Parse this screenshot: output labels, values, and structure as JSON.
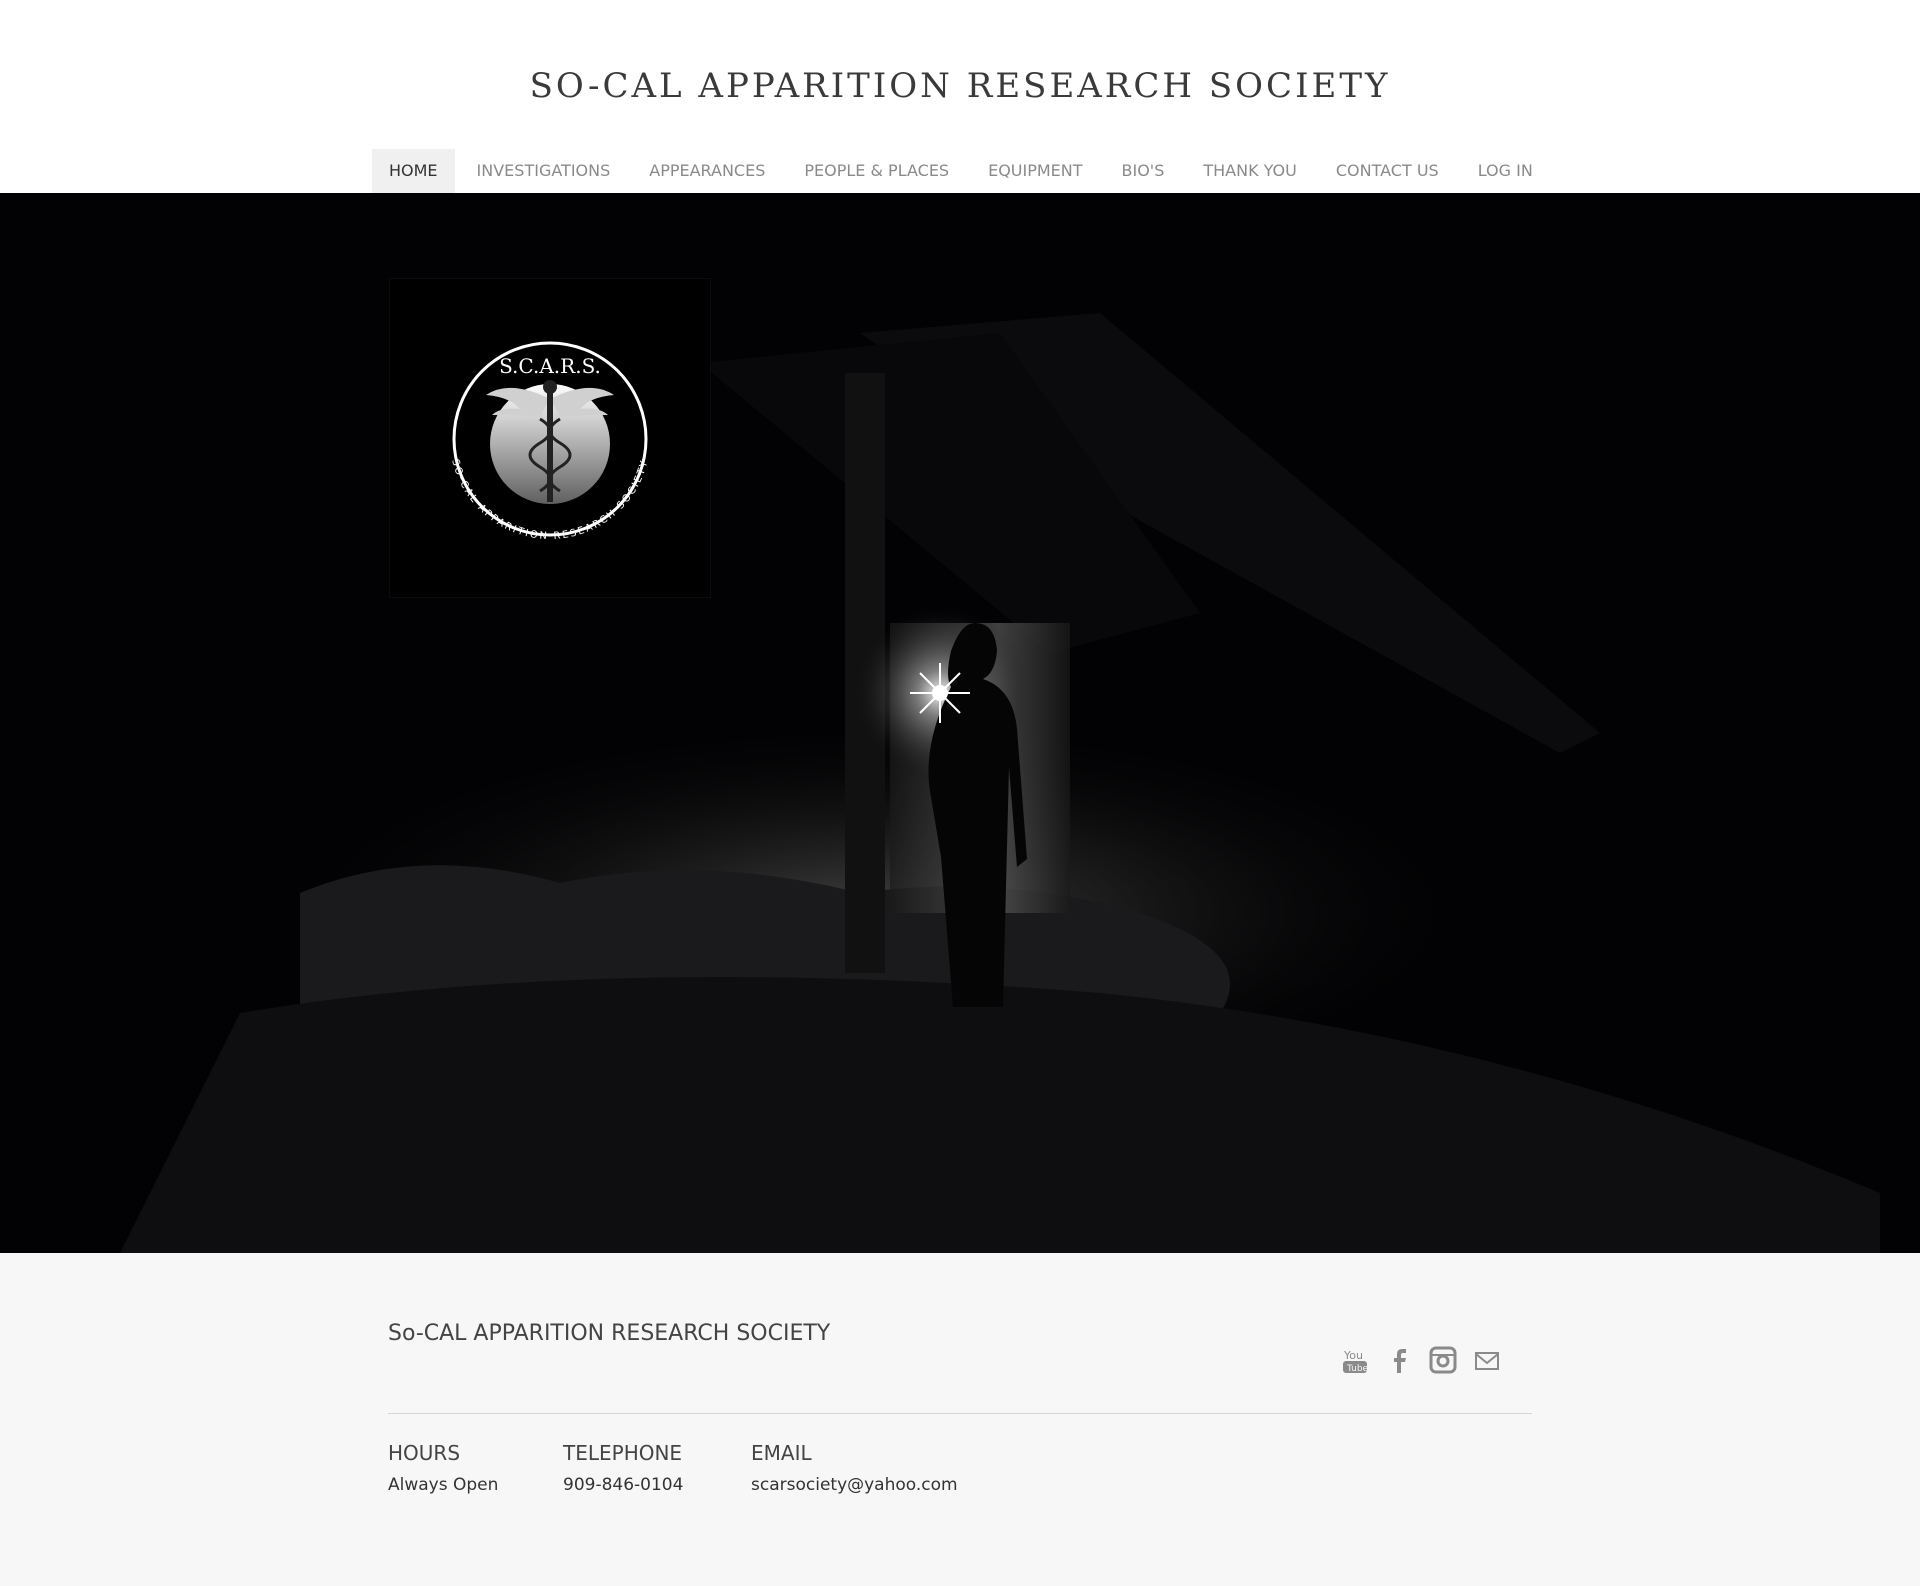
{
  "site": {
    "title": "SO-CAL APPARITION RESEARCH SOCIETY"
  },
  "nav": {
    "items": [
      {
        "label": "HOME",
        "active": true
      },
      {
        "label": "INVESTIGATIONS"
      },
      {
        "label": "APPEARANCES"
      },
      {
        "label": "PEOPLE & PLACES"
      },
      {
        "label": "EQUIPMENT"
      },
      {
        "label": "BIO'S"
      },
      {
        "label": "THANK YOU"
      },
      {
        "label": "CONTACT US"
      },
      {
        "label": "LOG IN"
      }
    ]
  },
  "hero": {
    "logo": {
      "top_text": "S.C.A.R.S.",
      "ring_text": "SO-CAL APPARITION RESEARCH SOCIETY"
    }
  },
  "footer": {
    "title": "So-CAL APPARITION RESEARCH SOCIETY",
    "social": [
      "youtube-icon",
      "facebook-icon",
      "instagram-icon",
      "mail-icon"
    ],
    "hours": {
      "heading": "HOURS",
      "value": "Always Open"
    },
    "telephone": {
      "heading": "TELEPHONE",
      "value": "909-846-0104"
    },
    "email": {
      "heading": "EMAIL",
      "value": "scarsociety@yahoo.com"
    }
  },
  "colors": {
    "hero_bg": "#020204",
    "footer_bg": "#f7f7f7",
    "nav_active_bg": "#f0f0f0"
  }
}
